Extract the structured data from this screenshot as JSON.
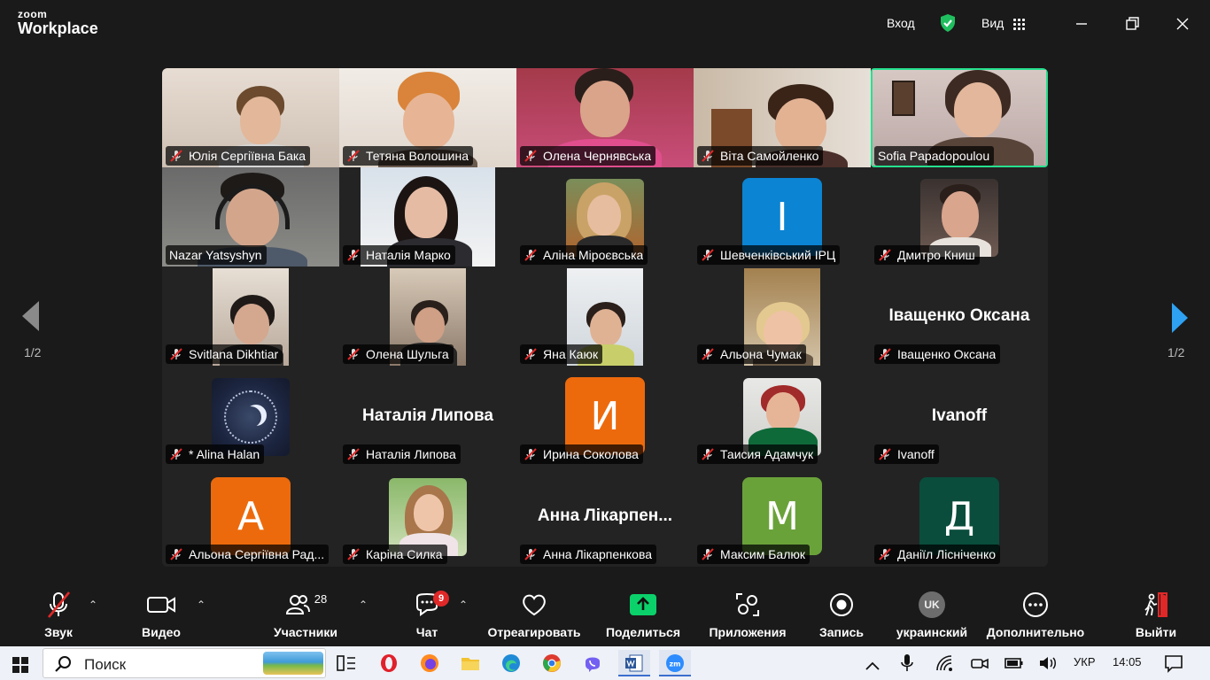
{
  "app": {
    "logo_line1": "zoom",
    "logo_line2": "Workplace",
    "signin_label": "Вход",
    "view_label": "Вид",
    "accent_color": "#27e08f"
  },
  "pager": {
    "left": "1/2",
    "right": "1/2"
  },
  "participants": [
    {
      "name": "Юлія Сергіївна Бака",
      "muted": true
    },
    {
      "name": "Тетяна Волошина",
      "muted": true
    },
    {
      "name": "Олена Чернявська",
      "muted": true
    },
    {
      "name": "Віта Самойленко",
      "muted": true
    },
    {
      "name": "Sofia Papadopoulou",
      "muted": false,
      "active": true
    },
    {
      "name": "Nazar Yatsyshyn",
      "muted": false
    },
    {
      "name": "Наталія Марко",
      "muted": true
    },
    {
      "name": "Аліна Міроєвська",
      "muted": true
    },
    {
      "name": "Шевченківський ІРЦ",
      "muted": true,
      "avatar": "І",
      "avatar_color": "#0b84d3"
    },
    {
      "name": "Дмитро Книш",
      "muted": true
    },
    {
      "name": "Svitlana Dikhtiar",
      "muted": true
    },
    {
      "name": "Олена Шульга",
      "muted": true
    },
    {
      "name": "Яна Каюк",
      "muted": true
    },
    {
      "name": "Альона Чумак",
      "muted": true
    },
    {
      "name": "Іващенко Оксана",
      "muted": true,
      "big_name": "Іващенко Оксана"
    },
    {
      "name": "* Alina Halan",
      "muted": true
    },
    {
      "name": "Наталія Липова",
      "muted": true,
      "big_name": "Наталія Липова"
    },
    {
      "name": "Ирина Соколова",
      "muted": true,
      "avatar": "И",
      "avatar_color": "#ed6a0c"
    },
    {
      "name": "Таисия Адамчук",
      "muted": true
    },
    {
      "name": "Ivanoff",
      "muted": true,
      "big_name": "Ivanoff"
    },
    {
      "name": "Альона Сергіївна Рад...",
      "muted": true,
      "avatar": "А",
      "avatar_color": "#ed6a0c"
    },
    {
      "name": "Каріна Силка",
      "muted": true
    },
    {
      "name": "Анна Лікарпенкова",
      "muted": true,
      "big_name": "Анна Лікарпен..."
    },
    {
      "name": "Максим Балюк",
      "muted": true,
      "avatar": "М",
      "avatar_color": "#6aa23a"
    },
    {
      "name": "Даніїл Лісніченко",
      "muted": true,
      "avatar": "Д",
      "avatar_color": "#0a4d3c"
    }
  ],
  "toolbar": {
    "audio": "Звук",
    "video": "Видео",
    "participants": "Участники",
    "participants_count": "28",
    "chat": "Чат",
    "chat_badge": "9",
    "react": "Отреагировать",
    "share": "Поделиться",
    "apps": "Приложения",
    "record": "Запись",
    "language": "украинский",
    "language_code": "UK",
    "more": "Дополнительно",
    "leave": "Выйти",
    "share_color": "#0bd16a",
    "leave_color": "#e02828"
  },
  "taskbar": {
    "search_label": "Поиск",
    "lang": "УКР",
    "time": "14:05"
  }
}
